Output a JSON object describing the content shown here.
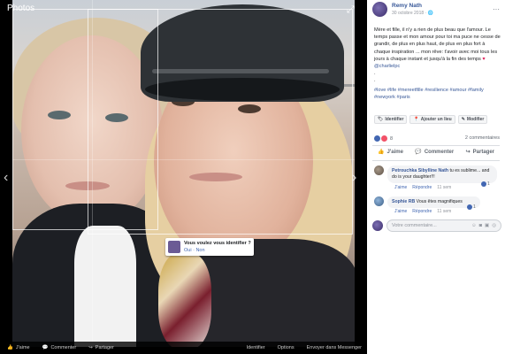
{
  "viewer": {
    "title": "Photos",
    "tag_popup": {
      "question": "Vous voulez vous identifier ?",
      "answer": "Oui · Non"
    },
    "bottom_bar": {
      "like": "J'aime",
      "comment": "Commenter",
      "share": "Partager",
      "right_items": [
        "Identifier",
        "Options",
        "Envoyer dans Messenger"
      ]
    }
  },
  "post": {
    "author": "Remy Nath",
    "date": "30 octobre 2018 · ",
    "text_part1": "Mère et fille, il n'y a rien de plus beau que l'amour. Le temps passe et mon amour pour toi ma puce ne cesse de grandir, de plus en plus haut, de plus en plus fort à chaque inspiration ... mon rêve: t'avoir avec moi tous les jours à chaque instant et jusqu'à la fin des temps ",
    "heart": "♥",
    "mention": "@charlielpc",
    "dots": ".\n.",
    "hashtags": "#love #life #mereetfille #resilience #amour #family #newyork #paris",
    "actions": [
      {
        "icon": "tag-icon",
        "label": "Identifier"
      },
      {
        "icon": "location-icon",
        "label": "Ajouter un lieu"
      },
      {
        "icon": "edit-icon",
        "label": "Modifier"
      }
    ],
    "reaction_count": "8",
    "comment_count": "2 commentaires",
    "action_bar": {
      "like": "J'aime",
      "comment": "Commenter",
      "share": "Partager"
    },
    "comments": [
      {
        "name": "Petrouchka Sibylline Nath",
        "text": " tu es sublime... and do is your daughter!!!",
        "like": "J'aime",
        "reply": "Répondre",
        "time": "11 sem",
        "reactions": "1"
      },
      {
        "name": "Sophie RB",
        "text": " Vous êtes magnifiques",
        "like": "J'aime",
        "reply": "Répondre",
        "time": "11 sem",
        "reactions": "1"
      }
    ],
    "write_placeholder": "Votre commentaire..."
  },
  "colors": {
    "link": "#385898",
    "accent": "#4267b2",
    "heart": "#e0245e"
  }
}
